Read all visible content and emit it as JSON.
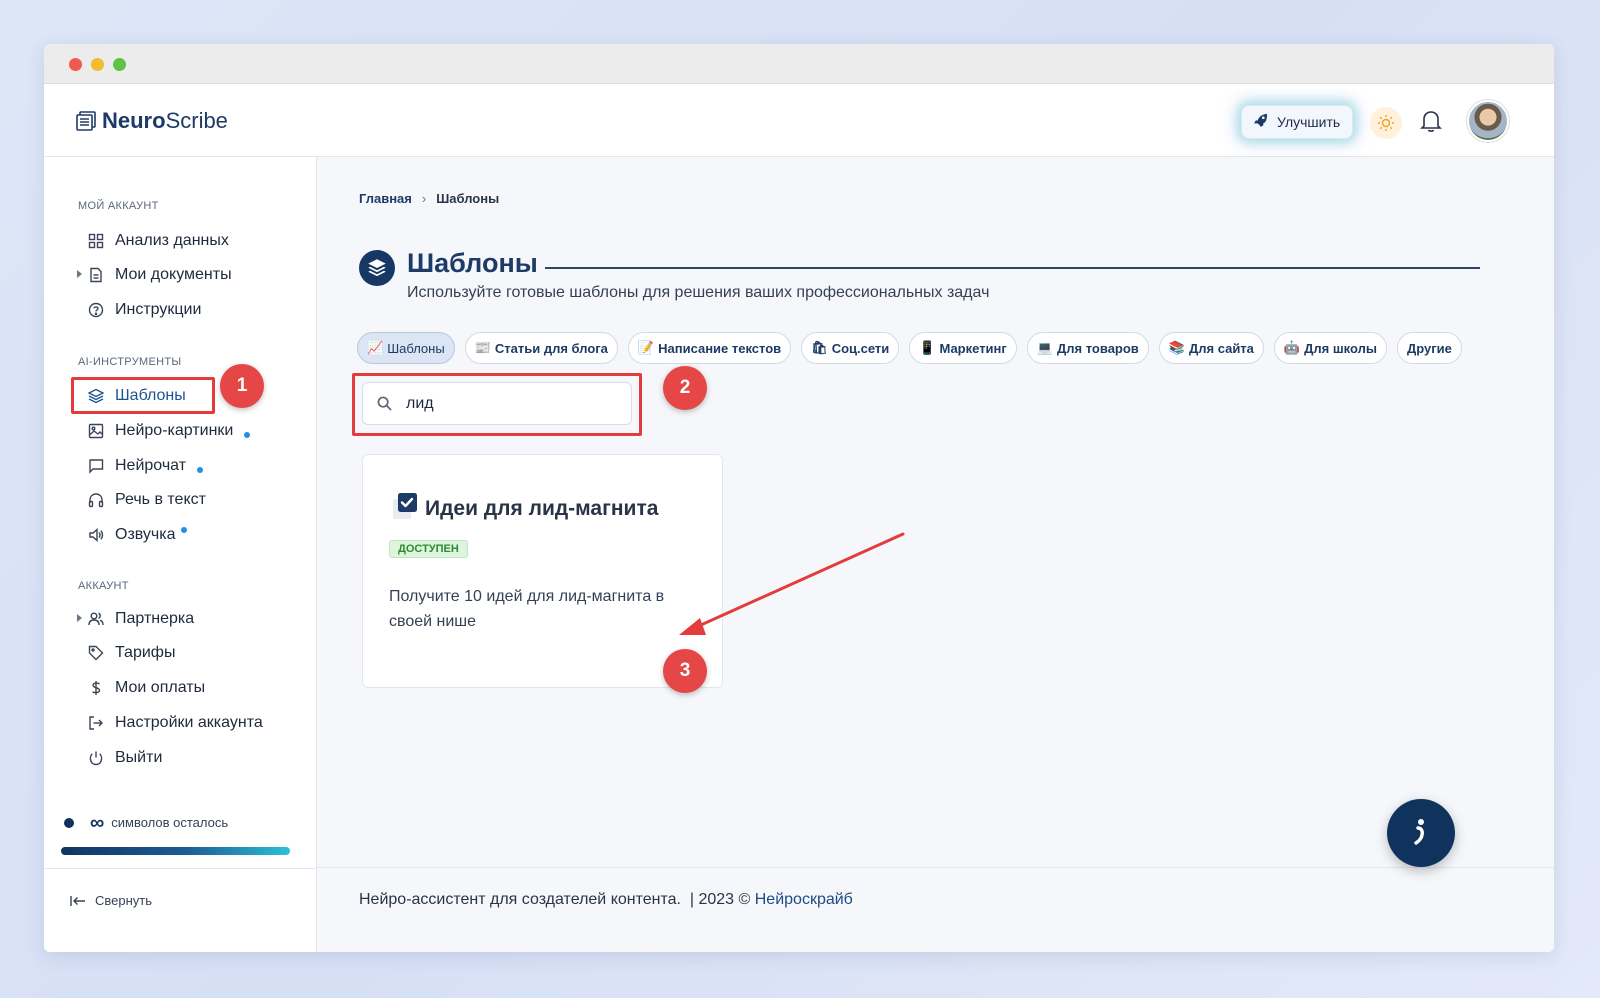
{
  "app": {
    "brand_bold": "Neuro",
    "brand_rest": "Scribe",
    "upgrade_label": "Улучшить"
  },
  "sidebar": {
    "sections": [
      {
        "title": "МОЙ АККАУНТ"
      },
      {
        "title": "AI-ИНСТРУМЕНТЫ"
      },
      {
        "title": "АККАУНТ"
      }
    ],
    "items": [
      {
        "label": "Анализ данных",
        "icon": "grid-icon"
      },
      {
        "label": "Мои документы",
        "icon": "document-icon"
      },
      {
        "label": "Инструкции",
        "icon": "help-icon"
      },
      {
        "label": "Шаблоны",
        "icon": "layers-icon"
      },
      {
        "label": "Нейро-картинки",
        "icon": "image-icon"
      },
      {
        "label": "Нейрочат",
        "icon": "chat-icon"
      },
      {
        "label": "Речь в текст",
        "icon": "headphones-icon"
      },
      {
        "label": "Озвучка",
        "icon": "speaker-icon"
      },
      {
        "label": "Партнерка",
        "icon": "users-icon"
      },
      {
        "label": "Тарифы",
        "icon": "tag-icon"
      },
      {
        "label": "Мои оплаты",
        "icon": "dollar-icon"
      },
      {
        "label": "Настройки аккаунта",
        "icon": "logout-box-icon"
      },
      {
        "label": "Выйти",
        "icon": "power-icon"
      }
    ],
    "credits_symbol": "∞",
    "credits_label": "символов осталось",
    "collapse_label": "Свернуть"
  },
  "annotations": [
    "1",
    "2",
    "3"
  ],
  "breadcrumb": {
    "home": "Главная",
    "separator": "›",
    "current": "Шаблоны"
  },
  "page": {
    "title": "Шаблоны",
    "subtitle": "Используйте готовые шаблоны для решения ваших профессиональных задач"
  },
  "chips": [
    {
      "emoji": "📈",
      "label": "Шаблоны",
      "active": true
    },
    {
      "emoji": "📰",
      "label": "Статьи для блога"
    },
    {
      "emoji": "📝",
      "label": "Написание текстов"
    },
    {
      "emoji": "🛍",
      "label": "Соц.сети"
    },
    {
      "emoji": "📱",
      "label": "Маркетинг"
    },
    {
      "emoji": "💻",
      "label": "Для товаров"
    },
    {
      "emoji": "📚",
      "label": "Для сайта"
    },
    {
      "emoji": "🤖",
      "label": "Для школы"
    },
    {
      "emoji": "",
      "label": "Другие"
    }
  ],
  "search": {
    "value": "лид"
  },
  "card": {
    "title": "Идеи для лид-магнита",
    "status": "ДОСТУПЕН",
    "description": "Получите 10 идей для лид-магнита в своей нише"
  },
  "footer": {
    "text": "Нейро-ассистент для создателей контента.  | 2023 © ",
    "brand": "Нейроскрайб"
  },
  "colors": {
    "primary": "#10335e",
    "accent_red": "#e54646",
    "status_green": "#2f8a33"
  }
}
